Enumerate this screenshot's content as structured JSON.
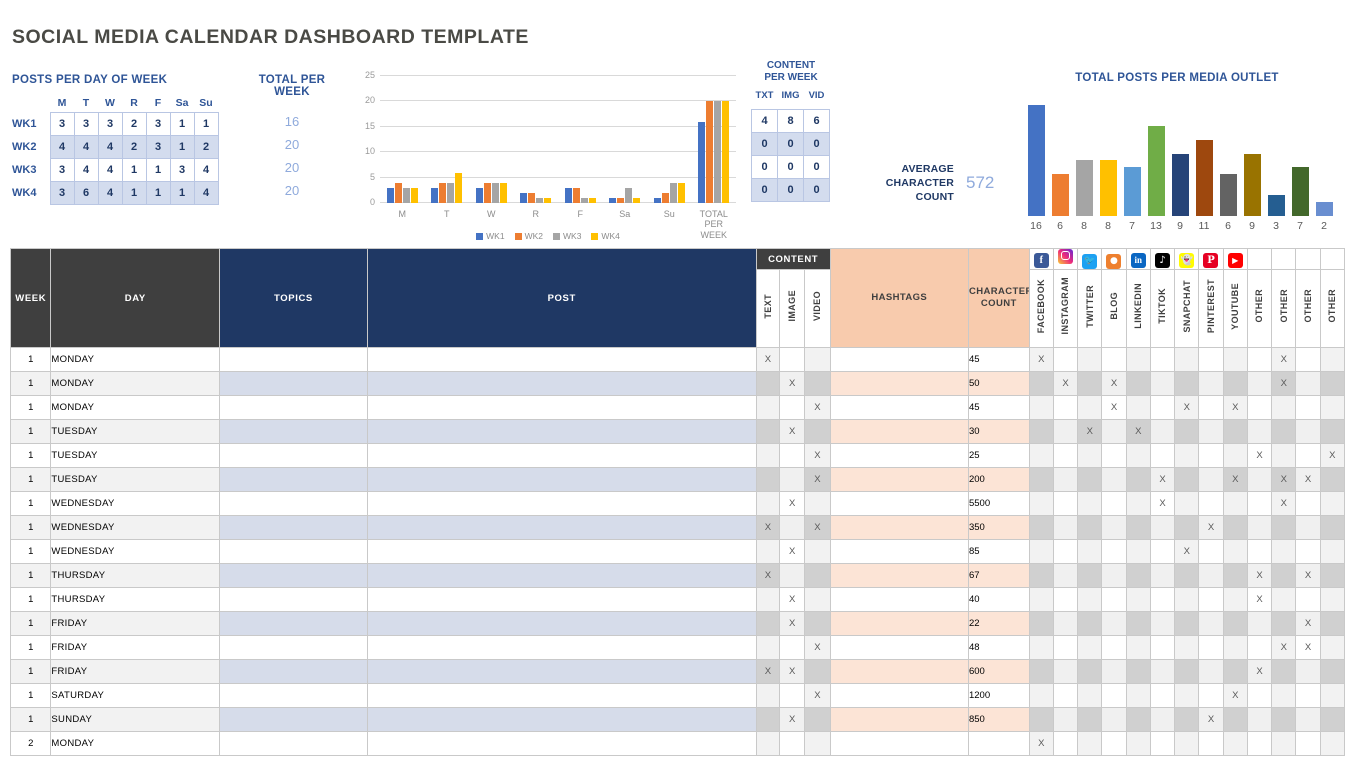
{
  "title": "SOCIAL MEDIA CALENDAR DASHBOARD TEMPLATE",
  "posts_per_day": {
    "heading": "POSTS PER DAY OF WEEK",
    "day_headers": [
      "M",
      "T",
      "W",
      "R",
      "F",
      "Sa",
      "Su"
    ],
    "rows": [
      {
        "label": "WK1",
        "values": [
          3,
          3,
          3,
          2,
          3,
          1,
          1
        ],
        "total": 16
      },
      {
        "label": "WK2",
        "values": [
          4,
          4,
          4,
          2,
          3,
          1,
          2
        ],
        "total": 20
      },
      {
        "label": "WK3",
        "values": [
          3,
          4,
          4,
          1,
          1,
          3,
          4
        ],
        "total": 20
      },
      {
        "label": "WK4",
        "values": [
          3,
          6,
          4,
          1,
          1,
          1,
          4
        ],
        "total": 20
      }
    ],
    "total_heading": "TOTAL PER WEEK"
  },
  "content_per_week": {
    "heading_line1": "CONTENT",
    "heading_line2": "PER WEEK",
    "columns": [
      "TXT",
      "IMG",
      "VID"
    ],
    "rows": [
      [
        4,
        8,
        6
      ],
      [
        0,
        0,
        0
      ],
      [
        0,
        0,
        0
      ],
      [
        0,
        0,
        0
      ]
    ]
  },
  "average_character_count": {
    "label_line1": "AVERAGE",
    "label_line2": "CHARACTER",
    "label_line3": "COUNT",
    "value": "572"
  },
  "chart_data": [
    {
      "type": "bar",
      "title": "POSTS PER DAY OF WEEK",
      "categories": [
        "M",
        "T",
        "W",
        "R",
        "F",
        "Sa",
        "Su",
        "TOTAL PER WEEK"
      ],
      "series": [
        {
          "name": "WK1",
          "color": "#4472c4",
          "values": [
            3,
            3,
            3,
            2,
            3,
            1,
            1,
            16
          ]
        },
        {
          "name": "WK2",
          "color": "#ed7d31",
          "values": [
            4,
            4,
            4,
            2,
            3,
            1,
            2,
            20
          ]
        },
        {
          "name": "WK3",
          "color": "#a5a5a5",
          "values": [
            3,
            4,
            4,
            1,
            1,
            3,
            4,
            20
          ]
        },
        {
          "name": "WK4",
          "color": "#ffc000",
          "values": [
            3,
            6,
            4,
            1,
            1,
            1,
            4,
            20
          ]
        }
      ],
      "yticks": [
        0,
        5,
        10,
        15,
        20,
        25
      ],
      "ylim": [
        0,
        25
      ],
      "grid": true,
      "legend": "bottom",
      "xlabel": "",
      "ylabel": ""
    },
    {
      "type": "bar",
      "title": "TOTAL POSTS PER MEDIA OUTLET",
      "categories": [
        "16",
        "6",
        "8",
        "8",
        "7",
        "13",
        "9",
        "11",
        "6",
        "9",
        "3",
        "7",
        "2"
      ],
      "values": [
        16,
        6,
        8,
        8,
        7,
        13,
        9,
        11,
        6,
        9,
        3,
        7,
        2
      ],
      "colors": [
        "#4472c4",
        "#ed7d31",
        "#a5a5a5",
        "#ffc000",
        "#5b9bd5",
        "#70ad47",
        "#264478",
        "#9e480e",
        "#636363",
        "#997300",
        "#255e91",
        "#43682b",
        "#698ed0"
      ],
      "ylim": [
        0,
        17
      ],
      "grid": false,
      "legend": "none",
      "xlabel": "",
      "ylabel": ""
    }
  ],
  "sheet": {
    "headers": {
      "week": "WEEK",
      "day": "DAY",
      "topics": "TOPICS",
      "post": "POST",
      "content_group": "CONTENT",
      "text": "TEXT",
      "image": "IMAGE",
      "video": "VIDEO",
      "hashtags": "HASHTAGS",
      "character_count": "CHARACTER COUNT",
      "outlets": [
        "FACEBOOK",
        "INSTAGRAM",
        "TWITTER",
        "BLOG",
        "LINKEDIN",
        "TIKTOK",
        "SNAPCHAT",
        "PINTEREST",
        "YOUTUBE",
        "OTHER",
        "OTHER",
        "OTHER",
        "OTHER"
      ],
      "outlet_icons": [
        "facebook-icon",
        "instagram-icon",
        "twitter-icon",
        "blog-rss-icon",
        "linkedin-icon",
        "tiktok-icon",
        "snapchat-icon",
        "pinterest-icon",
        "youtube-icon"
      ]
    },
    "mark": "X",
    "rows": [
      {
        "week": "1",
        "day": "MONDAY",
        "topics": "",
        "post": "",
        "text": "X",
        "image": "",
        "video": "",
        "hashtags": "",
        "chars": "45",
        "outlets": [
          1,
          0,
          0,
          0,
          0,
          0,
          0,
          0,
          0,
          0,
          1,
          0,
          0
        ]
      },
      {
        "week": "1",
        "day": "MONDAY",
        "topics": "",
        "post": "",
        "text": "",
        "image": "X",
        "video": "",
        "hashtags": "",
        "chars": "50",
        "outlets": [
          0,
          1,
          0,
          1,
          0,
          0,
          0,
          0,
          0,
          0,
          1,
          0,
          0
        ]
      },
      {
        "week": "1",
        "day": "MONDAY",
        "topics": "",
        "post": "",
        "text": "",
        "image": "",
        "video": "X",
        "hashtags": "",
        "chars": "45",
        "outlets": [
          0,
          0,
          0,
          1,
          0,
          0,
          1,
          0,
          1,
          0,
          0,
          0,
          0
        ]
      },
      {
        "week": "1",
        "day": "TUESDAY",
        "topics": "",
        "post": "",
        "text": "",
        "image": "X",
        "video": "",
        "hashtags": "",
        "chars": "30",
        "outlets": [
          0,
          0,
          1,
          0,
          1,
          0,
          0,
          0,
          0,
          0,
          0,
          0,
          0
        ]
      },
      {
        "week": "1",
        "day": "TUESDAY",
        "topics": "",
        "post": "",
        "text": "",
        "image": "",
        "video": "X",
        "hashtags": "",
        "chars": "25",
        "outlets": [
          0,
          0,
          0,
          0,
          0,
          0,
          0,
          0,
          0,
          1,
          0,
          0,
          1
        ]
      },
      {
        "week": "1",
        "day": "TUESDAY",
        "topics": "",
        "post": "",
        "text": "",
        "image": "",
        "video": "X",
        "hashtags": "",
        "chars": "200",
        "outlets": [
          0,
          0,
          0,
          0,
          0,
          1,
          0,
          0,
          1,
          0,
          1,
          1,
          0
        ]
      },
      {
        "week": "1",
        "day": "WEDNESDAY",
        "topics": "",
        "post": "",
        "text": "",
        "image": "X",
        "video": "",
        "hashtags": "",
        "chars": "5500",
        "outlets": [
          0,
          0,
          0,
          0,
          0,
          1,
          0,
          0,
          0,
          0,
          1,
          0,
          0
        ]
      },
      {
        "week": "1",
        "day": "WEDNESDAY",
        "topics": "",
        "post": "",
        "text": "X",
        "image": "",
        "video": "X",
        "hashtags": "",
        "chars": "350",
        "outlets": [
          0,
          0,
          0,
          0,
          0,
          0,
          0,
          1,
          0,
          0,
          0,
          0,
          0
        ]
      },
      {
        "week": "1",
        "day": "WEDNESDAY",
        "topics": "",
        "post": "",
        "text": "",
        "image": "X",
        "video": "",
        "hashtags": "",
        "chars": "85",
        "outlets": [
          0,
          0,
          0,
          0,
          0,
          0,
          1,
          0,
          0,
          0,
          0,
          0,
          0
        ]
      },
      {
        "week": "1",
        "day": "THURSDAY",
        "topics": "",
        "post": "",
        "text": "X",
        "image": "",
        "video": "",
        "hashtags": "",
        "chars": "67",
        "outlets": [
          0,
          0,
          0,
          0,
          0,
          0,
          0,
          0,
          0,
          1,
          0,
          1,
          0
        ]
      },
      {
        "week": "1",
        "day": "THURSDAY",
        "topics": "",
        "post": "",
        "text": "",
        "image": "X",
        "video": "",
        "hashtags": "",
        "chars": "40",
        "outlets": [
          0,
          0,
          0,
          0,
          0,
          0,
          0,
          0,
          0,
          1,
          0,
          0,
          0
        ]
      },
      {
        "week": "1",
        "day": "FRIDAY",
        "topics": "",
        "post": "",
        "text": "",
        "image": "X",
        "video": "",
        "hashtags": "",
        "chars": "22",
        "outlets": [
          0,
          0,
          0,
          0,
          0,
          0,
          0,
          0,
          0,
          0,
          0,
          1,
          0
        ]
      },
      {
        "week": "1",
        "day": "FRIDAY",
        "topics": "",
        "post": "",
        "text": "",
        "image": "",
        "video": "X",
        "hashtags": "",
        "chars": "48",
        "outlets": [
          0,
          0,
          0,
          0,
          0,
          0,
          0,
          0,
          0,
          0,
          1,
          1,
          0
        ]
      },
      {
        "week": "1",
        "day": "FRIDAY",
        "topics": "",
        "post": "",
        "text": "X",
        "image": "X",
        "video": "",
        "hashtags": "",
        "chars": "600",
        "outlets": [
          0,
          0,
          0,
          0,
          0,
          0,
          0,
          0,
          0,
          1,
          0,
          0,
          0
        ]
      },
      {
        "week": "1",
        "day": "SATURDAY",
        "topics": "",
        "post": "",
        "text": "",
        "image": "",
        "video": "X",
        "hashtags": "",
        "chars": "1200",
        "outlets": [
          0,
          0,
          0,
          0,
          0,
          0,
          0,
          0,
          1,
          0,
          0,
          0,
          0
        ]
      },
      {
        "week": "1",
        "day": "SUNDAY",
        "topics": "",
        "post": "",
        "text": "",
        "image": "X",
        "video": "",
        "hashtags": "",
        "chars": "850",
        "outlets": [
          0,
          0,
          0,
          0,
          0,
          0,
          0,
          1,
          0,
          0,
          0,
          0,
          0
        ]
      },
      {
        "week": "2",
        "day": "MONDAY",
        "topics": "",
        "post": "",
        "text": "",
        "image": "",
        "video": "",
        "hashtags": "",
        "chars": "",
        "outlets": [
          1,
          0,
          0,
          0,
          0,
          0,
          0,
          0,
          0,
          0,
          0,
          0,
          0
        ]
      }
    ]
  }
}
